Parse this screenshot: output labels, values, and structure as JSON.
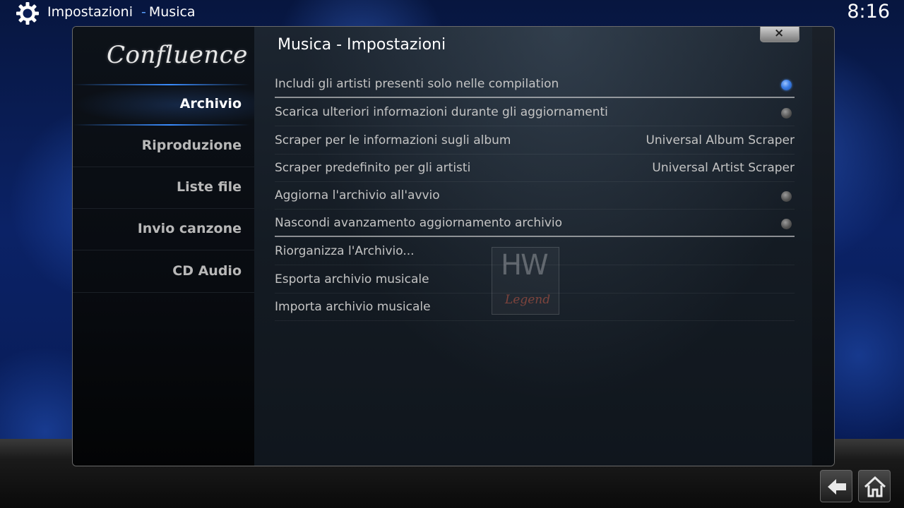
{
  "topbar": {
    "section": "Impostazioni",
    "separator": "-",
    "subsection": "Musica",
    "clock": "8:16"
  },
  "logo": "Confluence",
  "dialog": {
    "title": "Musica - Impostazioni",
    "close_label": "×"
  },
  "sidebar": {
    "items": [
      {
        "label": "Archivio",
        "active": true
      },
      {
        "label": "Riproduzione"
      },
      {
        "label": "Liste file"
      },
      {
        "label": "Invio canzone"
      },
      {
        "label": "CD Audio"
      }
    ]
  },
  "settings": [
    {
      "label": "Includi gli artisti presenti solo nelle compilation",
      "type": "toggle",
      "on": true
    },
    {
      "label": "Scarica ulteriori informazioni durante gli aggiornamenti",
      "type": "toggle",
      "on": false
    },
    {
      "label": "Scraper per le informazioni sugli album",
      "type": "value",
      "value": "Universal Album Scraper"
    },
    {
      "label": "Scraper predefinito per gli artisti",
      "type": "value",
      "value": "Universal Artist Scraper"
    },
    {
      "label": "Aggiorna l'archivio all'avvio",
      "type": "toggle",
      "on": false
    },
    {
      "label": "Nascondi avanzamento aggiornamento archivio",
      "type": "toggle",
      "on": false
    },
    {
      "label": "Riorganizza l'Archivio...",
      "type": "action"
    },
    {
      "label": "Esporta archivio musicale",
      "type": "action"
    },
    {
      "label": "Importa archivio musicale",
      "type": "action"
    }
  ],
  "watermark": {
    "mark": "HW",
    "text": "Legend"
  },
  "colors": {
    "accent": "#3a8cff",
    "toggle_on": "#3d7fe6",
    "toggle_off": "#555555"
  },
  "icons": {
    "settings": "gear-icon",
    "back": "back-arrow-icon",
    "home": "home-icon",
    "close": "close-icon"
  }
}
